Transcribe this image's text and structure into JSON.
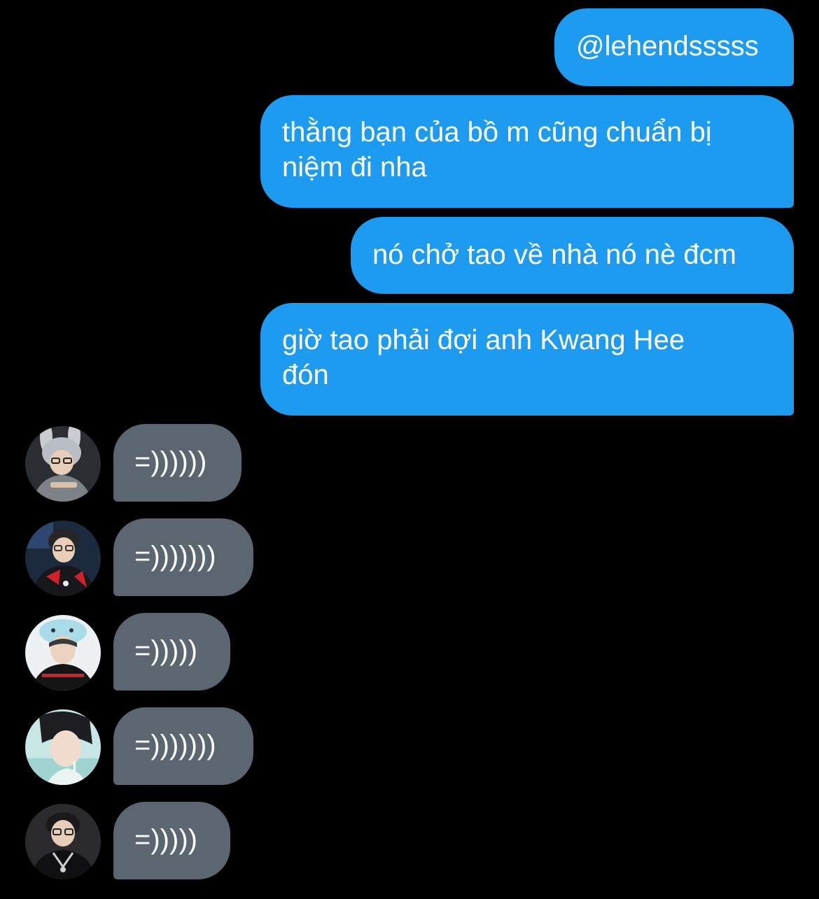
{
  "conversation": {
    "outgoing": [
      {
        "text": "@lehendsssss"
      },
      {
        "text": "thằng bạn của bồ m cũng chuẩn bị\nniệm đi nha"
      },
      {
        "text": "nó chở tao về nhà nó nè đcm"
      },
      {
        "text": "giờ tao phải đợi anh Kwang Hee\nđón"
      }
    ],
    "incoming": [
      {
        "text": "=))))))",
        "avatar_icon": "user-avatar-icon"
      },
      {
        "text": "=)))))))",
        "avatar_icon": "user-avatar-icon"
      },
      {
        "text": "=)))))",
        "avatar_icon": "user-avatar-icon"
      },
      {
        "text": "=)))))))",
        "avatar_icon": "user-avatar-icon"
      },
      {
        "text": "=)))))",
        "avatar_icon": "user-avatar-icon"
      }
    ]
  },
  "colors": {
    "background": "#000000",
    "outgoing_bubble": "#1d9bf0",
    "incoming_bubble": "#5b6670",
    "text": "#ffffff"
  }
}
